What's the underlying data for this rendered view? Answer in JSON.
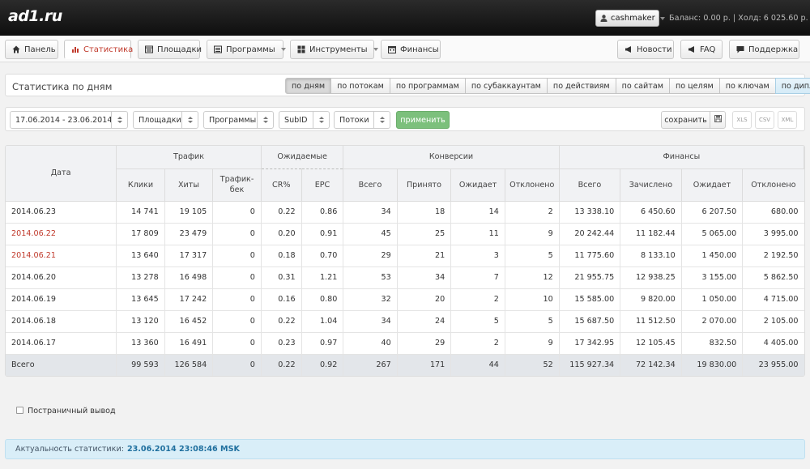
{
  "header": {
    "logo": "ad1.ru",
    "user": "cashmaker",
    "balance_label": "Баланс:",
    "balance_value": "0.00 р.",
    "separator": "|",
    "hold_label": "Холд:",
    "hold_value": "6 025.60 р."
  },
  "nav": {
    "left": [
      {
        "label": "Панель",
        "icon": "home-icon"
      },
      {
        "label": "Статистика",
        "icon": "chart-icon"
      },
      {
        "label": "Площадки",
        "icon": "window-icon"
      },
      {
        "label": "Программы",
        "icon": "list-icon"
      },
      {
        "label": "Инструменты",
        "icon": "grid-icon"
      },
      {
        "label": "Финансы",
        "icon": "calendar-icon"
      }
    ],
    "right": [
      {
        "label": "Новости",
        "icon": "megaphone-icon"
      },
      {
        "label": "FAQ",
        "icon": "megaphone-icon"
      },
      {
        "label": "Поддержка",
        "icon": "chat-icon"
      }
    ]
  },
  "stats_panel": {
    "title": "Статистика по дням",
    "tabs": [
      "по дням",
      "по потокам",
      "по программам",
      "по субаккаунтам",
      "по действиям",
      "по сайтам",
      "по целям",
      "по ключам",
      "по диплинкам"
    ]
  },
  "filters": {
    "date_range": "17.06.2014 - 23.06.2014",
    "sites": "Площадки",
    "programs": "Программы",
    "subid": "SubID",
    "streams": "Потоки",
    "apply": "применить",
    "save": "сохранить",
    "formats": [
      "XLS",
      "CSV",
      "XML"
    ]
  },
  "table": {
    "groups": {
      "traffic": "Трафик",
      "expected": "Ожидаемые",
      "conversions": "Конверсии",
      "finance": "Финансы"
    },
    "columns": [
      "Дата",
      "Клики",
      "Хиты",
      "Трафик-бек",
      "CR%",
      "EPC",
      "Всего",
      "Принято",
      "Ожидает",
      "Отклонено",
      "Всего",
      "Зачислено",
      "Ожидает",
      "Отклонено"
    ],
    "rows": [
      {
        "date": "2014.06.23",
        "weekend": false,
        "v": [
          "14 741",
          "19 105",
          "0",
          "0.22",
          "0.86",
          "34",
          "18",
          "14",
          "2",
          "13 338.10",
          "6 450.60",
          "6 207.50",
          "680.00"
        ]
      },
      {
        "date": "2014.06.22",
        "weekend": true,
        "v": [
          "17 809",
          "23 479",
          "0",
          "0.20",
          "0.91",
          "45",
          "25",
          "11",
          "9",
          "20 242.44",
          "11 182.44",
          "5 065.00",
          "3 995.00"
        ]
      },
      {
        "date": "2014.06.21",
        "weekend": true,
        "v": [
          "13 640",
          "17 317",
          "0",
          "0.18",
          "0.70",
          "29",
          "21",
          "3",
          "5",
          "11 775.60",
          "8 133.10",
          "1 450.00",
          "2 192.50"
        ]
      },
      {
        "date": "2014.06.20",
        "weekend": false,
        "v": [
          "13 278",
          "16 498",
          "0",
          "0.31",
          "1.21",
          "53",
          "34",
          "7",
          "12",
          "21 955.75",
          "12 938.25",
          "3 155.00",
          "5 862.50"
        ]
      },
      {
        "date": "2014.06.19",
        "weekend": false,
        "v": [
          "13 645",
          "17 242",
          "0",
          "0.16",
          "0.80",
          "32",
          "20",
          "2",
          "10",
          "15 585.00",
          "9 820.00",
          "1 050.00",
          "4 715.00"
        ]
      },
      {
        "date": "2014.06.18",
        "weekend": false,
        "v": [
          "13 120",
          "16 452",
          "0",
          "0.22",
          "1.04",
          "34",
          "24",
          "5",
          "5",
          "15 687.50",
          "11 512.50",
          "2 070.00",
          "2 105.00"
        ]
      },
      {
        "date": "2014.06.17",
        "weekend": false,
        "v": [
          "13 360",
          "16 491",
          "0",
          "0.23",
          "0.97",
          "40",
          "29",
          "2",
          "9",
          "17 342.95",
          "12 105.45",
          "832.50",
          "4 405.00"
        ]
      }
    ],
    "total": {
      "label": "Всего",
      "v": [
        "99 593",
        "126 584",
        "0",
        "0.22",
        "0.92",
        "267",
        "171",
        "44",
        "52",
        "115 927.34",
        "72 142.34",
        "19 830.00",
        "23 955.00"
      ]
    }
  },
  "pagination_label": "Постраничный вывод",
  "status": {
    "label": "Актуальность статистики:",
    "value": "23.06.2014 23:08:46 MSK"
  },
  "colors": {
    "weekend_date": "#c0392b",
    "apply_button": "#7cc07c",
    "status_bar": "#d9eef8"
  }
}
